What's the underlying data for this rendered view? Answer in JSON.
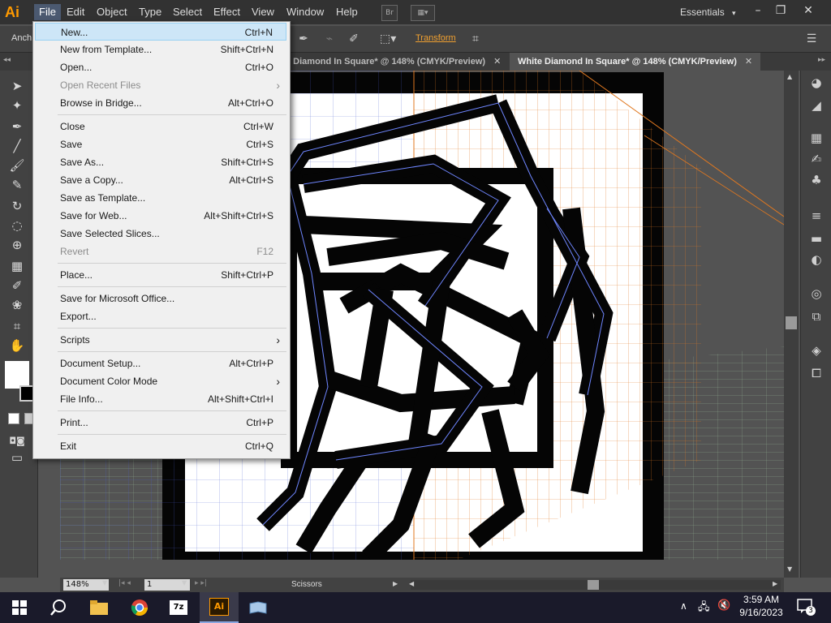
{
  "app": {
    "logo": "Ai"
  },
  "menubar": {
    "items": [
      "File",
      "Edit",
      "Object",
      "Type",
      "Select",
      "Effect",
      "View",
      "Window",
      "Help"
    ],
    "bridge_label": "Br",
    "workspace": "Essentials"
  },
  "controlbar": {
    "anchor_label": "Anch",
    "transform_label": "Transform"
  },
  "tabs": [
    {
      "label": "e Diamond In Square* @ 148% (CMYK/Preview)"
    },
    {
      "label": "White Diamond In Square* @ 148% (CMYK/Preview)"
    }
  ],
  "filemenu": {
    "items": [
      {
        "label": "New...",
        "shortcut": "Ctrl+N",
        "highlighted": true
      },
      {
        "label": "New from Template...",
        "shortcut": "Shift+Ctrl+N"
      },
      {
        "label": "Open...",
        "shortcut": "Ctrl+O"
      },
      {
        "label": "Open Recent Files",
        "shortcut": "",
        "disabled": true,
        "submenu": true
      },
      {
        "label": "Browse in Bridge...",
        "shortcut": "Alt+Ctrl+O"
      },
      {
        "sep": true
      },
      {
        "label": "Close",
        "shortcut": "Ctrl+W"
      },
      {
        "label": "Save",
        "shortcut": "Ctrl+S"
      },
      {
        "label": "Save As...",
        "shortcut": "Shift+Ctrl+S"
      },
      {
        "label": "Save a Copy...",
        "shortcut": "Alt+Ctrl+S"
      },
      {
        "label": "Save as Template...",
        "shortcut": ""
      },
      {
        "label": "Save for Web...",
        "shortcut": "Alt+Shift+Ctrl+S"
      },
      {
        "label": "Save Selected Slices...",
        "shortcut": ""
      },
      {
        "label": "Revert",
        "shortcut": "F12",
        "disabled": true
      },
      {
        "sep": true
      },
      {
        "label": "Place...",
        "shortcut": "Shift+Ctrl+P"
      },
      {
        "sep": true
      },
      {
        "label": "Save for Microsoft Office...",
        "shortcut": ""
      },
      {
        "label": "Export...",
        "shortcut": ""
      },
      {
        "sep": true
      },
      {
        "label": "Scripts",
        "shortcut": "",
        "submenu": true
      },
      {
        "sep": true
      },
      {
        "label": "Document Setup...",
        "shortcut": "Alt+Ctrl+P"
      },
      {
        "label": "Document Color Mode",
        "shortcut": "",
        "submenu": true
      },
      {
        "label": "File Info...",
        "shortcut": "Alt+Shift+Ctrl+I"
      },
      {
        "sep": true
      },
      {
        "label": "Print...",
        "shortcut": "Ctrl+P"
      },
      {
        "sep": true
      },
      {
        "label": "Exit",
        "shortcut": "Ctrl+Q"
      }
    ]
  },
  "statusbar": {
    "zoom": "148%",
    "page": "1",
    "tool": "Scissors"
  },
  "clock": {
    "time": "3:59 AM",
    "date": "9/16/2023"
  },
  "notifications": {
    "count": "3"
  },
  "colors": {
    "accent": "#ff9a00",
    "menu_highlight": "#cde6f7",
    "perspective_orange": "#e07820",
    "perspective_blue": "#4a5fd0"
  }
}
